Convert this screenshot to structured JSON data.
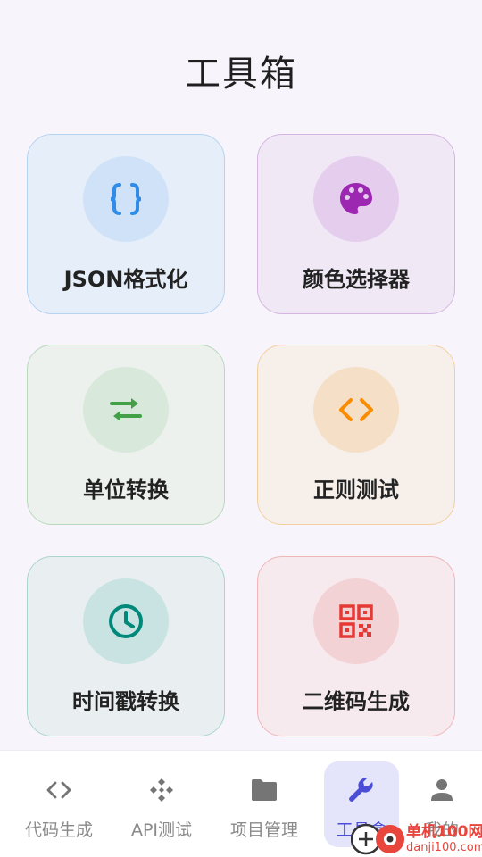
{
  "page": {
    "title": "工具箱"
  },
  "tools": [
    {
      "label": "JSON格式化",
      "icon": "braces-icon",
      "accent": "#2f8ce8",
      "bg": "#e6eef9",
      "border": "#b3d3f2",
      "circle": "#cfe2f7"
    },
    {
      "label": "颜色选择器",
      "icon": "palette-icon",
      "accent": "#9c27b0",
      "bg": "#f0e9f5",
      "border": "#d5b4e2",
      "circle": "#e5cdee"
    },
    {
      "label": "单位转换",
      "icon": "swap-arrows-icon",
      "accent": "#43a047",
      "bg": "#ecf1ee",
      "border": "#b9d9bd",
      "circle": "#d8e8da"
    },
    {
      "label": "正则测试",
      "icon": "code-icon",
      "accent": "#fb8c00",
      "bg": "#f6efea",
      "border": "#f3cf9f",
      "circle": "#f5dfc7"
    },
    {
      "label": "时间戳转换",
      "icon": "clock-icon",
      "accent": "#00897b",
      "bg": "#e9eff1",
      "border": "#a9d4cf",
      "circle": "#c8e3e2"
    },
    {
      "label": "二维码生成",
      "icon": "qr-code-icon",
      "accent": "#e53935",
      "bg": "#f6eaee",
      "border": "#f0b6b8",
      "circle": "#f3d2d5"
    }
  ],
  "nav": {
    "items": [
      {
        "label": "代码生成",
        "icon": "code-brackets-icon",
        "active": false
      },
      {
        "label": "API测试",
        "icon": "api-icon",
        "active": false
      },
      {
        "label": "项目管理",
        "icon": "folder-icon",
        "active": false
      },
      {
        "label": "工具盒",
        "icon": "wrench-icon",
        "active": true
      },
      {
        "label": "我的",
        "icon": "person-icon",
        "active": false
      }
    ]
  },
  "watermark": {
    "cn": "单机100网",
    "en": "danji100.com",
    "color": "#e8453c"
  }
}
